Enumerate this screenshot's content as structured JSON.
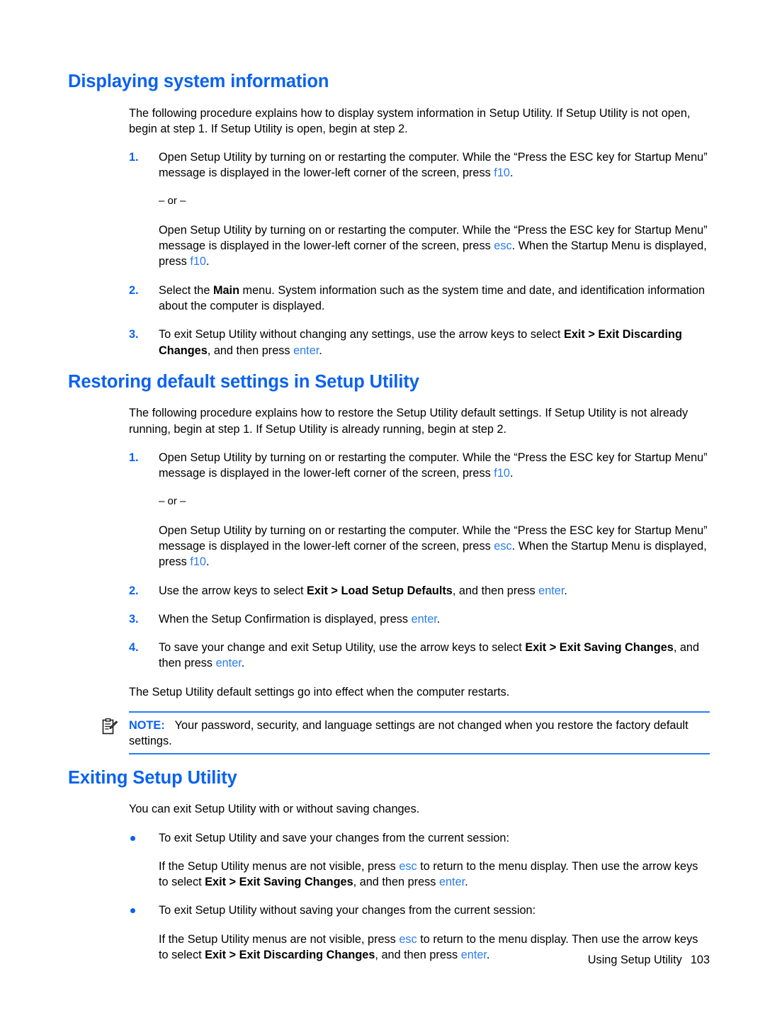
{
  "document": {
    "sections": [
      {
        "heading": "Displaying system information",
        "intro": "The following procedure explains how to display system information in Setup Utility. If Setup Utility is not open, begin at step 1. If Setup Utility is open, begin at step 2.",
        "steps": [
          {
            "marker": "1.",
            "text_pre": "Open Setup Utility by turning on or restarting the computer. While the “Press the ESC key for Startup Menu” message is displayed in the lower-left corner of the screen, press ",
            "key1": "f10",
            "text_post": "."
          },
          {
            "marker": "2.",
            "text_pre": "Select the ",
            "bold1": "Main",
            "text_mid": " menu. System information such as the system time and date, and identification information about the computer is displayed.",
            "text_post": ""
          },
          {
            "marker": "3.",
            "text_pre": "To exit Setup Utility without changing any settings, use the arrow keys to select ",
            "bold1": "Exit > Exit Discarding Changes",
            "text_mid": ", and then press ",
            "key1": "enter",
            "text_post": "."
          }
        ],
        "or_label": "– or –",
        "alt_step": {
          "text_pre": "Open Setup Utility by turning on or restarting the computer. While the “Press the ESC key for Startup Menu” message is displayed in the lower-left corner of the screen, press ",
          "key1": "esc",
          "text_mid": ". When the Startup Menu is displayed, press ",
          "key2": "f10",
          "text_post": "."
        }
      },
      {
        "heading": "Restoring default settings in Setup Utility",
        "intro": "The following procedure explains how to restore the Setup Utility default settings. If Setup Utility is not already running, begin at step 1. If Setup Utility is already running, begin at step 2.",
        "steps": [
          {
            "marker": "1.",
            "text_pre": "Open Setup Utility by turning on or restarting the computer. While the “Press the ESC key for Startup Menu” message is displayed in the lower-left corner of the screen, press ",
            "key1": "f10",
            "text_post": "."
          },
          {
            "marker": "2.",
            "text_pre": "Use the arrow keys to select ",
            "bold1": "Exit > Load Setup Defaults",
            "text_mid": ", and then press ",
            "key1": "enter",
            "text_post": "."
          },
          {
            "marker": "3.",
            "text_pre": "When the Setup Confirmation is displayed, press ",
            "key1": "enter",
            "text_post": "."
          },
          {
            "marker": "4.",
            "text_pre": "To save your change and exit Setup Utility, use the arrow keys to select ",
            "bold1": "Exit > Exit Saving Changes",
            "text_mid": ", and then press ",
            "key1": "enter",
            "text_post": "."
          }
        ],
        "or_label": "– or –",
        "alt_step": {
          "text_pre": "Open Setup Utility by turning on or restarting the computer. While the “Press the ESC key for Startup Menu” message is displayed in the lower-left corner of the screen, press ",
          "key1": "esc",
          "text_mid": ". When the Startup Menu is displayed, press ",
          "key2": "f10",
          "text_post": "."
        },
        "closing": "The Setup Utility default settings go into effect when the computer restarts."
      },
      {
        "heading": "Exiting Setup Utility",
        "intro": "You can exit Setup Utility with or without saving changes.",
        "bullets": [
          {
            "lead": "To exit Setup Utility and save your changes from the current session:",
            "detail_pre": "If the Setup Utility menus are not visible, press ",
            "key1": "esc",
            "detail_mid": " to return to the menu display. Then use the arrow keys to select ",
            "bold1": "Exit > Exit Saving Changes",
            "detail_mid2": ", and then press ",
            "key2": "enter",
            "detail_post": "."
          },
          {
            "lead": "To exit Setup Utility without saving your changes from the current session:",
            "detail_pre": "If the Setup Utility menus are not visible, press ",
            "key1": "esc",
            "detail_mid": " to return to the menu display. Then use the arrow keys to select ",
            "bold1": "Exit > Exit Discarding Changes",
            "detail_mid2": ", and then press ",
            "key2": "enter",
            "detail_post": "."
          }
        ]
      }
    ],
    "note": {
      "label": "NOTE:",
      "text": "Your password, security, and language settings are not changed when you restore the factory default settings.",
      "icon": "note-clipboard-icon"
    },
    "footer": {
      "title": "Using Setup Utility",
      "page_number": "103"
    },
    "colors": {
      "heading_blue": "#0a62f0",
      "key_blue": "#2a7cf0",
      "bullet_blue": "#0a62f0",
      "rule_blue": "#2a7cf0",
      "body_text": "#000000",
      "background": "#ffffff"
    }
  }
}
